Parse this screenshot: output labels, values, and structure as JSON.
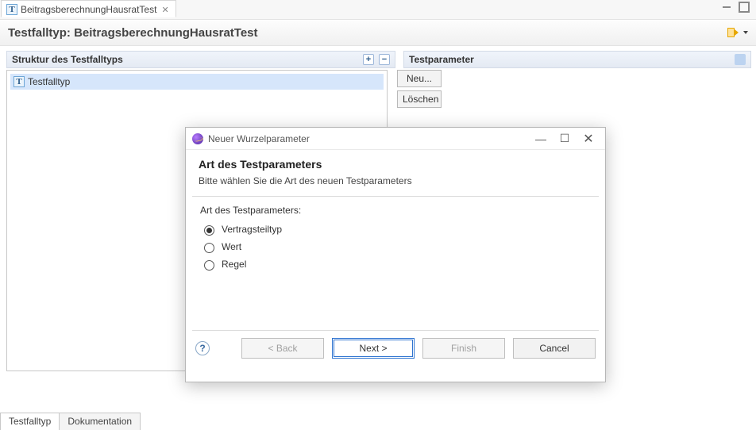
{
  "editor_tab": {
    "label": "BeitragsberechnungHausratTest",
    "close_glyph": "✕"
  },
  "form": {
    "title": "Testfalltyp: BeitragsberechnungHausratTest"
  },
  "sections": {
    "structure_title": "Struktur des Testfalltyps",
    "testparams_title": "Testparameter"
  },
  "tree": {
    "root_label": "Testfalltyp"
  },
  "side_buttons": {
    "new": "Neu...",
    "delete": "Löschen"
  },
  "page_tabs": {
    "testfalltyp": "Testfalltyp",
    "dokumentation": "Dokumentation"
  },
  "dialog": {
    "window_title": "Neuer Wurzelparameter",
    "heading": "Art des Testparameters",
    "subheading": "Bitte wählen Sie die Art des neuen Testparameters",
    "group_label": "Art des Testparameters:",
    "options": {
      "vertragsteiltyp": "Vertragsteiltyp",
      "wert": "Wert",
      "regel": "Regel"
    },
    "selected_option": "vertragsteiltyp",
    "buttons": {
      "back": "< Back",
      "next": "Next >",
      "finish": "Finish",
      "cancel": "Cancel"
    }
  }
}
